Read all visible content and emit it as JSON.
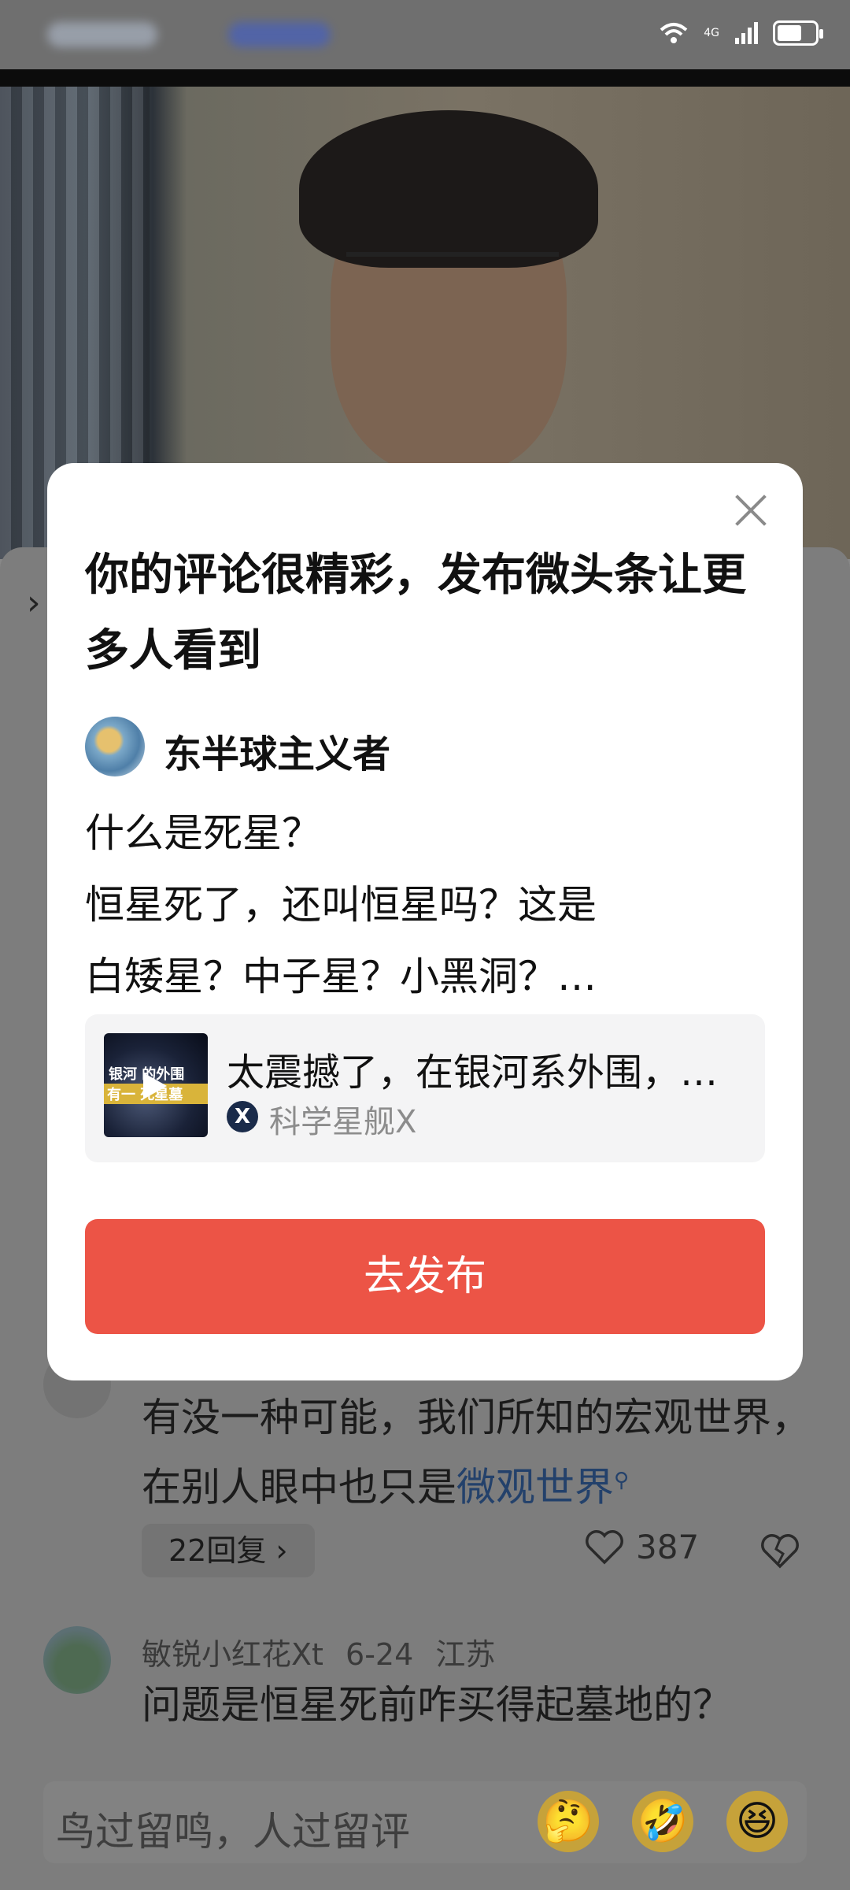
{
  "colors": {
    "accent": "#ec5446",
    "overlay": "#888888",
    "link": "#23416b"
  },
  "status_bar": {
    "network": "4G",
    "icons": [
      "wifi-icon",
      "signal-icon",
      "battery-icon"
    ]
  },
  "dialog": {
    "title": "你的评论很精彩，发布微头条让更多人看到",
    "author": "东半球主义者",
    "comment_lines": [
      "什么是死星？",
      "恒星死了，还叫恒星吗？这是",
      "白矮星？中子星？小黑洞？…"
    ],
    "article": {
      "title": "太震撼了，在银河系外围，…",
      "source": "科学星舰X",
      "thumb_line1": "银河 的外围",
      "thumb_line2": "有一 死星墓"
    },
    "publish_label": "去发布"
  },
  "comments": [
    {
      "text_before": "有没一种可能，我们所知的宏观世界，在别人眼中也只是",
      "link_text": "微观世界",
      "replies": "22回复 ›",
      "likes": "387"
    },
    {
      "author": "敏锐小红花Xt",
      "date": "6-24",
      "location": "江苏",
      "text": "问题是恒星死前咋买得起墓地的？"
    }
  ],
  "input": {
    "placeholder": "鸟过留鸣，人过留评",
    "emojis": [
      "🤔",
      "🤣",
      "😆"
    ]
  }
}
